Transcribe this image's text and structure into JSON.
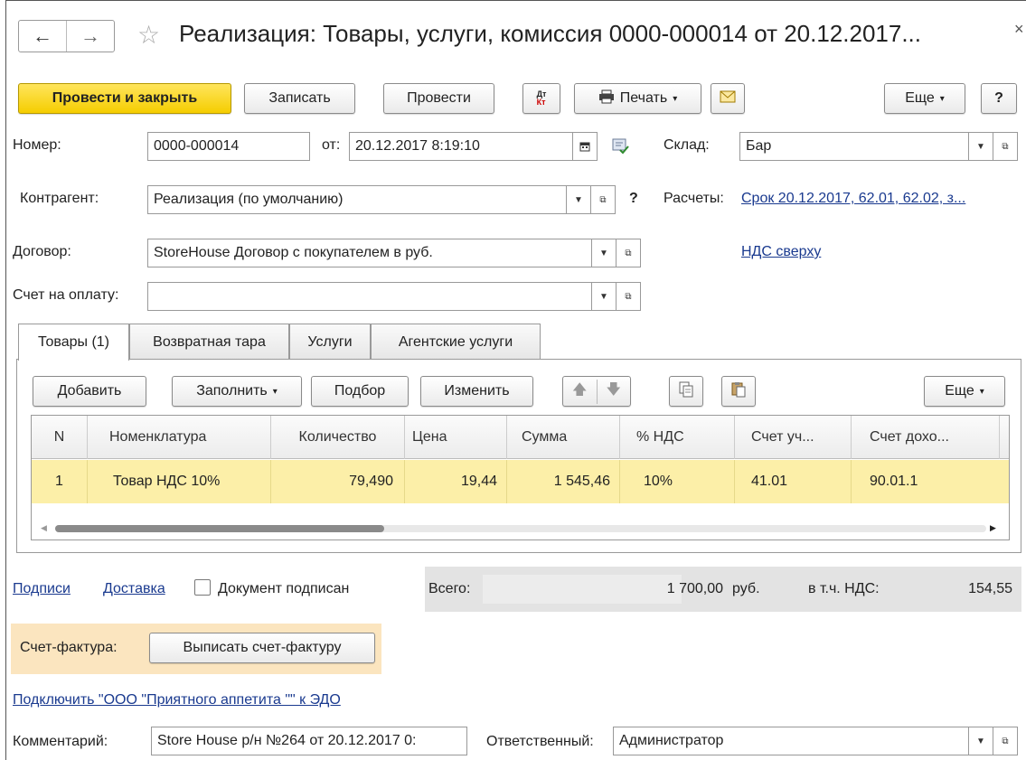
{
  "window": {
    "title": "Реализация: Товары, услуги, комиссия 0000-000014 от 20.12.2017...",
    "close_glyph": "×"
  },
  "toolbar": {
    "post_close": "Провести и закрыть",
    "save": "Записать",
    "post": "Провести",
    "dt_kt": "Дт Кт",
    "print": "Печать",
    "more": "Еще",
    "help": "?"
  },
  "form": {
    "number_label": "Номер:",
    "number_value": "0000-000014",
    "from_label": "от:",
    "date_value": "20.12.2017  8:19:10",
    "warehouse_label": "Склад:",
    "warehouse_value": "Бар",
    "counterparty_label": "Контрагент:",
    "counterparty_value": "Реализация (по умолчанию)",
    "payments_label": "Расчеты:",
    "payments_link": "Срок 20.12.2017, 62.01, 62.02, з...",
    "contract_label": "Договор:",
    "contract_value": "StoreHouse Договор с покупателем в руб.",
    "vat_link": "НДС сверху",
    "invoice_label": "Счет на оплату:",
    "invoice_value": "",
    "question": "?"
  },
  "tabs": [
    {
      "label": "Товары (1)",
      "active": true
    },
    {
      "label": "Возвратная тара",
      "active": false
    },
    {
      "label": "Услуги",
      "active": false
    },
    {
      "label": "Агентские услуги",
      "active": false
    }
  ],
  "table_toolbar": {
    "add": "Добавить",
    "fill": "Заполнить",
    "pick": "Подбор",
    "change": "Изменить",
    "more": "Еще"
  },
  "table": {
    "columns": [
      "N",
      "Номенклатура",
      "Количество",
      "Цена",
      "Сумма",
      "% НДС",
      "Счет уч...",
      "Счет дохо..."
    ],
    "rows": [
      [
        "1",
        "Товар НДС 10%",
        "79,490",
        "19,44",
        "1 545,46",
        "10%",
        "41.01",
        "90.01.1"
      ]
    ]
  },
  "footer": {
    "signatures_link": "Подписи",
    "delivery_link": "Доставка",
    "signed_label": "Документ подписан",
    "signed_checked": false,
    "total_label": "Всего:",
    "total_value": "1 700,00",
    "currency": "руб.",
    "vat_label": "в т.ч. НДС:",
    "vat_value": "154,55",
    "invoice_label": "Счет-фактура:",
    "invoice_button": "Выписать счет-фактуру",
    "edo_link": "Подключить \"ООО \"Приятного аппетита \"\" к ЭДО",
    "comment_label": "Комментарий:",
    "comment_value": "Store House р/н №264 от 20.12.2017 0:",
    "responsible_label": "Ответственный:",
    "responsible_value": "Администратор"
  },
  "colors": {
    "primary_button": "#f5cd00",
    "selected_row": "#fcefa8",
    "link": "#1a3a8f",
    "invoice_panel": "#fbe5bf",
    "totals_panel": "#e3e3e3"
  },
  "icons": [
    "back-arrow-icon",
    "forward-arrow-icon",
    "star-icon",
    "printer-icon",
    "envelope-icon",
    "calendar-icon",
    "document-check-icon",
    "open-form-icon",
    "arrow-up-icon",
    "arrow-down-icon",
    "copy-icon",
    "paste-icon"
  ]
}
